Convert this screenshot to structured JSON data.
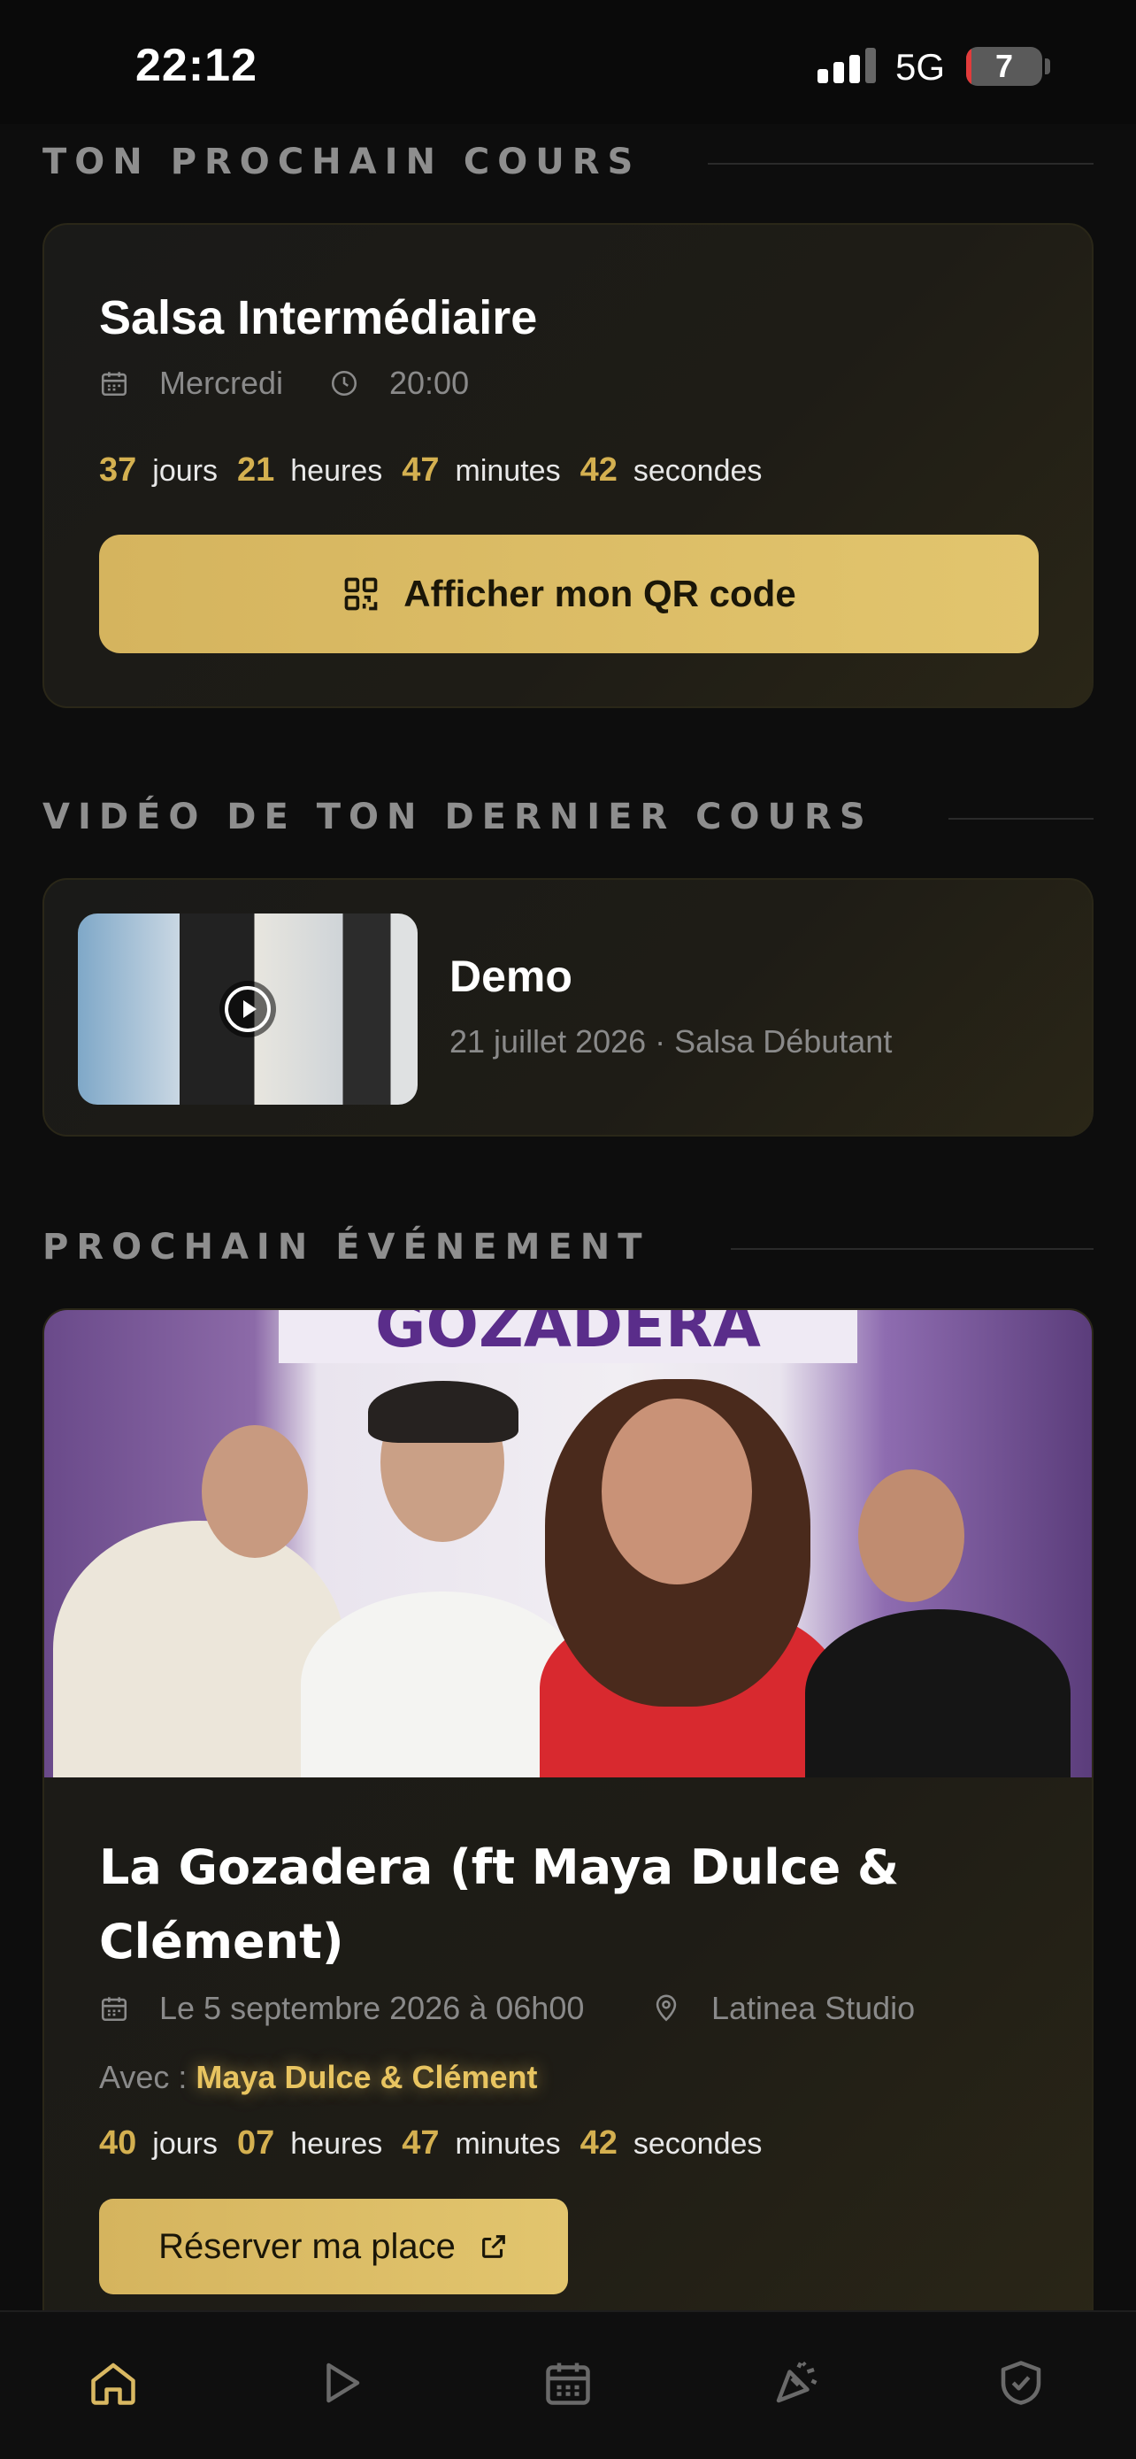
{
  "status_bar": {
    "time": "22:12",
    "network": "5G",
    "battery": "7",
    "battery_level_percent": 7
  },
  "next_course": {
    "section_title": "TON PROCHAIN COURS",
    "name": "Salsa Intermédiaire",
    "day": "Mercredi",
    "time": "20:00",
    "countdown": {
      "days": "37",
      "days_label": "jours",
      "hours": "21",
      "hours_label": "heures",
      "minutes": "47",
      "minutes_label": "minutes",
      "seconds": "42",
      "seconds_label": "secondes"
    },
    "qr_button_label": "Afficher mon QR code"
  },
  "last_video": {
    "section_title": "VIDÉO DE TON DERNIER COURS",
    "title": "Demo",
    "subtitle": "21 juillet 2026 · Salsa Débutant"
  },
  "next_event": {
    "section_title": "PROCHAIN ÉVÉNEMENT",
    "banner_text": "GOZADERA",
    "title": "La Gozadera (ft Maya Dulce & Clément)",
    "date": "Le 5 septembre 2026 à 06h00",
    "location": "Latinea Studio",
    "with_label": "Avec :",
    "with_names": "Maya Dulce & Clément",
    "countdown": {
      "days": "40",
      "days_label": "jours",
      "hours": "07",
      "hours_label": "heures",
      "minutes": "47",
      "minutes_label": "minutes",
      "seconds": "42",
      "seconds_label": "secondes"
    },
    "reserve_button_label": "Réserver ma place"
  },
  "colors": {
    "accent": "#d9b862",
    "background": "#0d0d0d",
    "muted_text": "#8a8a8a"
  },
  "bottom_nav": {
    "items": [
      "home-icon",
      "play-icon",
      "calendar-icon",
      "party-popper-icon",
      "shield-check-icon"
    ],
    "active": "home-icon"
  }
}
